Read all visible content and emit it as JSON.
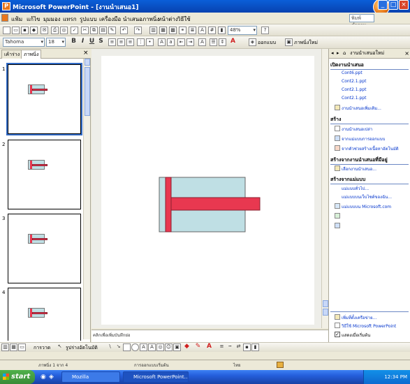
{
  "window": {
    "title": "Microsoft PowerPoint - [งานนำเสนอ1]"
  },
  "menu": {
    "items": [
      "แฟ้ม",
      "แก้ไข",
      "มุมมอง",
      "แทรก",
      "รูปแบบ",
      "เครื่องมือ",
      "นำเสนอภาพนิ่ง",
      "หน้าต่าง",
      "วิธีใช้"
    ],
    "help_placeholder": "พิมพ์คำถาม"
  },
  "toolbar": {
    "zoom": "48%",
    "font": "Tahoma",
    "size": "18",
    "design_label": "ออกแบบ",
    "new_slide_label": "ภาพนิ่งใหม่"
  },
  "leftpane": {
    "tab_outline": "เค้าร่าง",
    "tab_slides": "ภาพนิ่ง",
    "slide_numbers": [
      "1",
      "2",
      "3",
      "4"
    ]
  },
  "notes": {
    "placeholder": "คลิกเพื่อเพิ่มบันทึกย่อ"
  },
  "taskpane": {
    "title": "งานนำเสนอใหม่",
    "sec_open": "เปิดงานนำเสนอ",
    "recent": [
      "Cont6.ppt",
      "Cont2.1.ppt",
      "Cont2.1.ppt",
      "Cont2.1.ppt"
    ],
    "more": "งานนำเสนอเพิ่มเติม...",
    "sec_new": "สร้าง",
    "new_items": [
      "งานนำเสนอเปล่า",
      "จากแม่แบบการออกแบบ",
      "จากตัวช่วยสร้างเนื้อหาอัตโนมัติ"
    ],
    "sec_existing": "สร้างจากงานนำเสนอที่มีอยู่",
    "existing_link": "เลือกงานนำเสนอ...",
    "sec_template": "สร้างจากแม่แบบ",
    "template_items": [
      "แม่แบบทั่วไป...",
      "แม่แบบบนเว็บไซต์ของฉัน...",
      "แม่แบบบน Microsoft.com"
    ],
    "bottom_items": [
      "เพิ่มที่ตั้งเครือข่าย...",
      "วิธีใช้ Microsoft PowerPoint",
      "แสดงเมื่อเริ่มต้น"
    ]
  },
  "viewbar": {
    "draw_label": "การวาด",
    "autoshapes_label": "รูปร่างอัตโนมัติ"
  },
  "statusbar": {
    "slide_info": "ภาพนิ่ง 1 จาก 4",
    "design": "การออกแบบเริ่มต้น",
    "language": "ไทย"
  },
  "taskbar": {
    "start": "start",
    "items": [
      "Mozilla",
      "Microsoft PowerPoint..."
    ],
    "clock": "12:34 PM"
  },
  "colors": {
    "accent_red": "#e83850",
    "box_fill": "#bfdfe4"
  }
}
